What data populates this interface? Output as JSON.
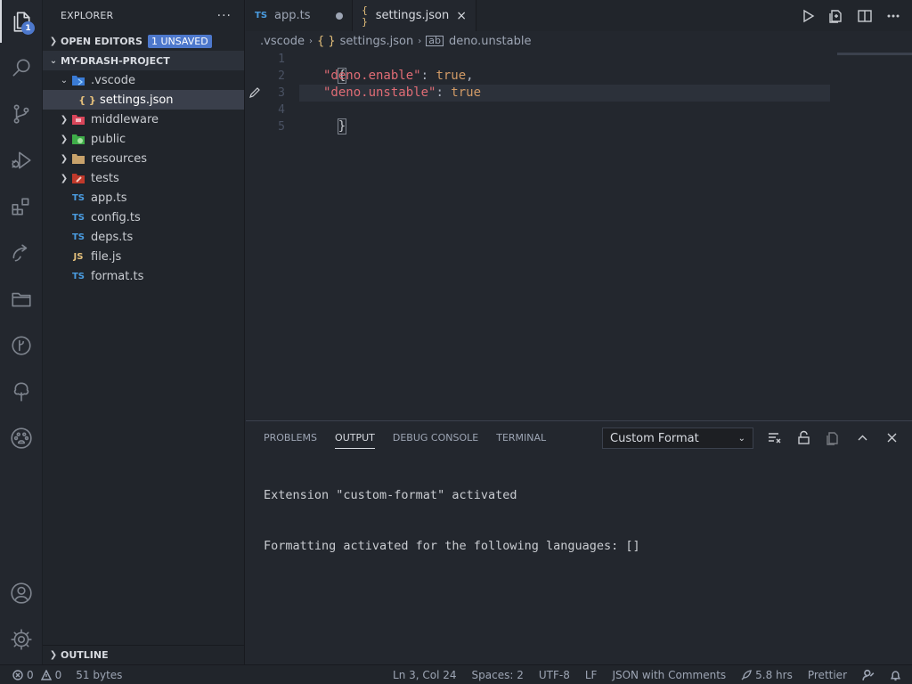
{
  "activity_bar": {
    "explorer_badge": "1",
    "icons": [
      "files-icon",
      "search-icon",
      "source-control-icon",
      "run-debug-icon",
      "extensions-icon",
      "remote-explorer-icon",
      "folders-icon",
      "git-graph-icon",
      "tree-icon",
      "paw-icon",
      "account-icon",
      "gear-icon"
    ]
  },
  "sidebar": {
    "title": "EXPLORER",
    "more": "···",
    "open_editors_label": "OPEN EDITORS",
    "unsaved_badge": "1 UNSAVED",
    "project_label": "MY-DRASH-PROJECT",
    "tree": [
      {
        "label": ".vscode",
        "type": "folder-open",
        "icon": "vscode-folder-icon"
      },
      {
        "label": "settings.json",
        "type": "json",
        "icon": "json-file-icon",
        "icon_text": "{ }"
      },
      {
        "label": "middleware",
        "type": "folder",
        "icon": "middleware-folder-icon"
      },
      {
        "label": "public",
        "type": "folder",
        "icon": "public-folder-icon"
      },
      {
        "label": "resources",
        "type": "folder",
        "icon": "resources-folder-icon"
      },
      {
        "label": "tests",
        "type": "folder",
        "icon": "tests-folder-icon"
      },
      {
        "label": "app.ts",
        "type": "ts",
        "icon_text": "TS"
      },
      {
        "label": "config.ts",
        "type": "ts",
        "icon_text": "TS"
      },
      {
        "label": "deps.ts",
        "type": "ts",
        "icon_text": "TS"
      },
      {
        "label": "file.js",
        "type": "js",
        "icon_text": "JS"
      },
      {
        "label": "format.ts",
        "type": "ts",
        "icon_text": "TS"
      }
    ],
    "outline_label": "OUTLINE"
  },
  "tabs": [
    {
      "label": "app.ts",
      "icon_text": "TS"
    },
    {
      "label": "settings.json",
      "icon_text": "{ }",
      "close": "×"
    }
  ],
  "breadcrumb": {
    "folder": ".vscode",
    "json_icon_text": "{ }",
    "file": "settings.json",
    "key": "deno.unstable",
    "sep": "›"
  },
  "editor": {
    "line_numbers": [
      "1",
      "2",
      "3",
      "4",
      "5"
    ],
    "lines": {
      "l1": "{",
      "l2_key": "\"deno.enable\"",
      "l2_colon": ": ",
      "l2_val": "true",
      "l2_comma": ",",
      "l3_key": "\"deno.unstable\"",
      "l3_colon": ": ",
      "l3_val": "true",
      "l4": "}"
    }
  },
  "panel": {
    "tabs": [
      "PROBLEMS",
      "OUTPUT",
      "DEBUG CONSOLE",
      "TERMINAL"
    ],
    "active_tab": "OUTPUT",
    "output_channel": "Custom Format",
    "output_lines": [
      "Extension \"custom-format\" activated",
      "Formatting activated for the following languages: []"
    ]
  },
  "status_bar": {
    "errors": "0",
    "warnings": "0",
    "size": "51 bytes",
    "position": "Ln 3, Col 24",
    "spaces": "Spaces: 2",
    "encoding": "UTF-8",
    "eol": "LF",
    "language": "JSON with Comments",
    "time": "5.8 hrs",
    "formatter": "Prettier"
  },
  "colors": {
    "accent": "#4d78cc",
    "background": "#23272e",
    "sidebar": "#21252b",
    "selection": "#3a3f4b"
  }
}
